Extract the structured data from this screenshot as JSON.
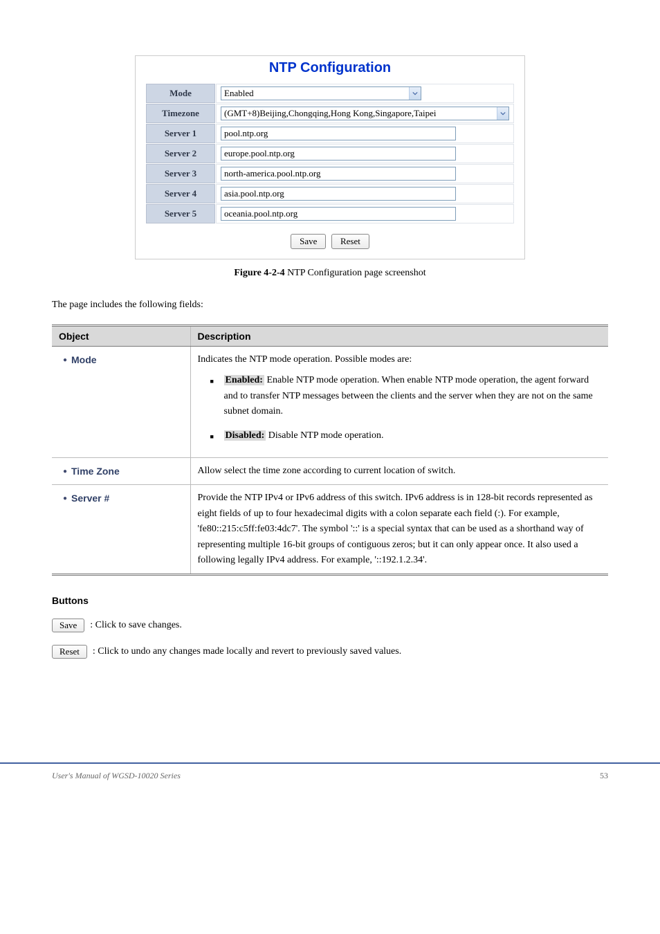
{
  "figure": {
    "title": "NTP Configuration",
    "rows": {
      "mode": {
        "label": "Mode",
        "value": "Enabled"
      },
      "timezone": {
        "label": "Timezone",
        "value": "(GMT+8)Beijing,Chongqing,Hong Kong,Singapore,Taipei"
      },
      "server1": {
        "label": "Server 1",
        "value": "pool.ntp.org"
      },
      "server2": {
        "label": "Server 2",
        "value": "europe.pool.ntp.org"
      },
      "server3": {
        "label": "Server 3",
        "value": "north-america.pool.ntp.org"
      },
      "server4": {
        "label": "Server 4",
        "value": "asia.pool.ntp.org"
      },
      "server5": {
        "label": "Server 5",
        "value": "oceania.pool.ntp.org"
      }
    },
    "buttons": {
      "save": "Save",
      "reset": "Reset"
    }
  },
  "caption_prefix": "Figure 4-2-4 ",
  "caption_text": "NTP Configuration page screenshot",
  "section_intro": "The page includes the following fields:",
  "table": {
    "headers": {
      "object": "Object",
      "description": "Description"
    },
    "mode": {
      "name": "Mode",
      "desc_intro": "Indicates the NTP mode operation. Possible modes are:",
      "enabled_label": "Enabled:",
      "enabled_text": " Enable NTP mode operation. When enable NTP mode operation, the agent forward and to transfer NTP messages between the clients and the server when they are not on the same subnet domain.",
      "disabled_label": "Disabled:",
      "disabled_text": " Disable NTP mode operation."
    },
    "timezone": {
      "name": "Time Zone",
      "desc": "Allow select the time zone according to current location of switch."
    },
    "server": {
      "name": "Server #",
      "desc": "Provide the NTP IPv4 or IPv6 address of this switch. IPv6 address is in 128-bit records represented as eight fields of up to four hexadecimal digits with a colon separate each field (:). For example, 'fe80::215:c5ff:fe03:4dc7'. The symbol '::' is a special syntax that can be used as a shorthand way of representing multiple 16-bit groups of contiguous zeros; but it can only appear once. It also used a following legally IPv4 address. For example, '::192.1.2.34'."
    }
  },
  "buttons_section": {
    "heading": "Buttons",
    "save": {
      "label": "Save",
      "desc": ": Click to save changes."
    },
    "reset": {
      "label": "Reset",
      "desc": ": Click to undo any changes made locally and revert to previously saved values."
    }
  },
  "footer": {
    "left": "User's Manual of WGSD-10020 Series",
    "right": "53"
  }
}
